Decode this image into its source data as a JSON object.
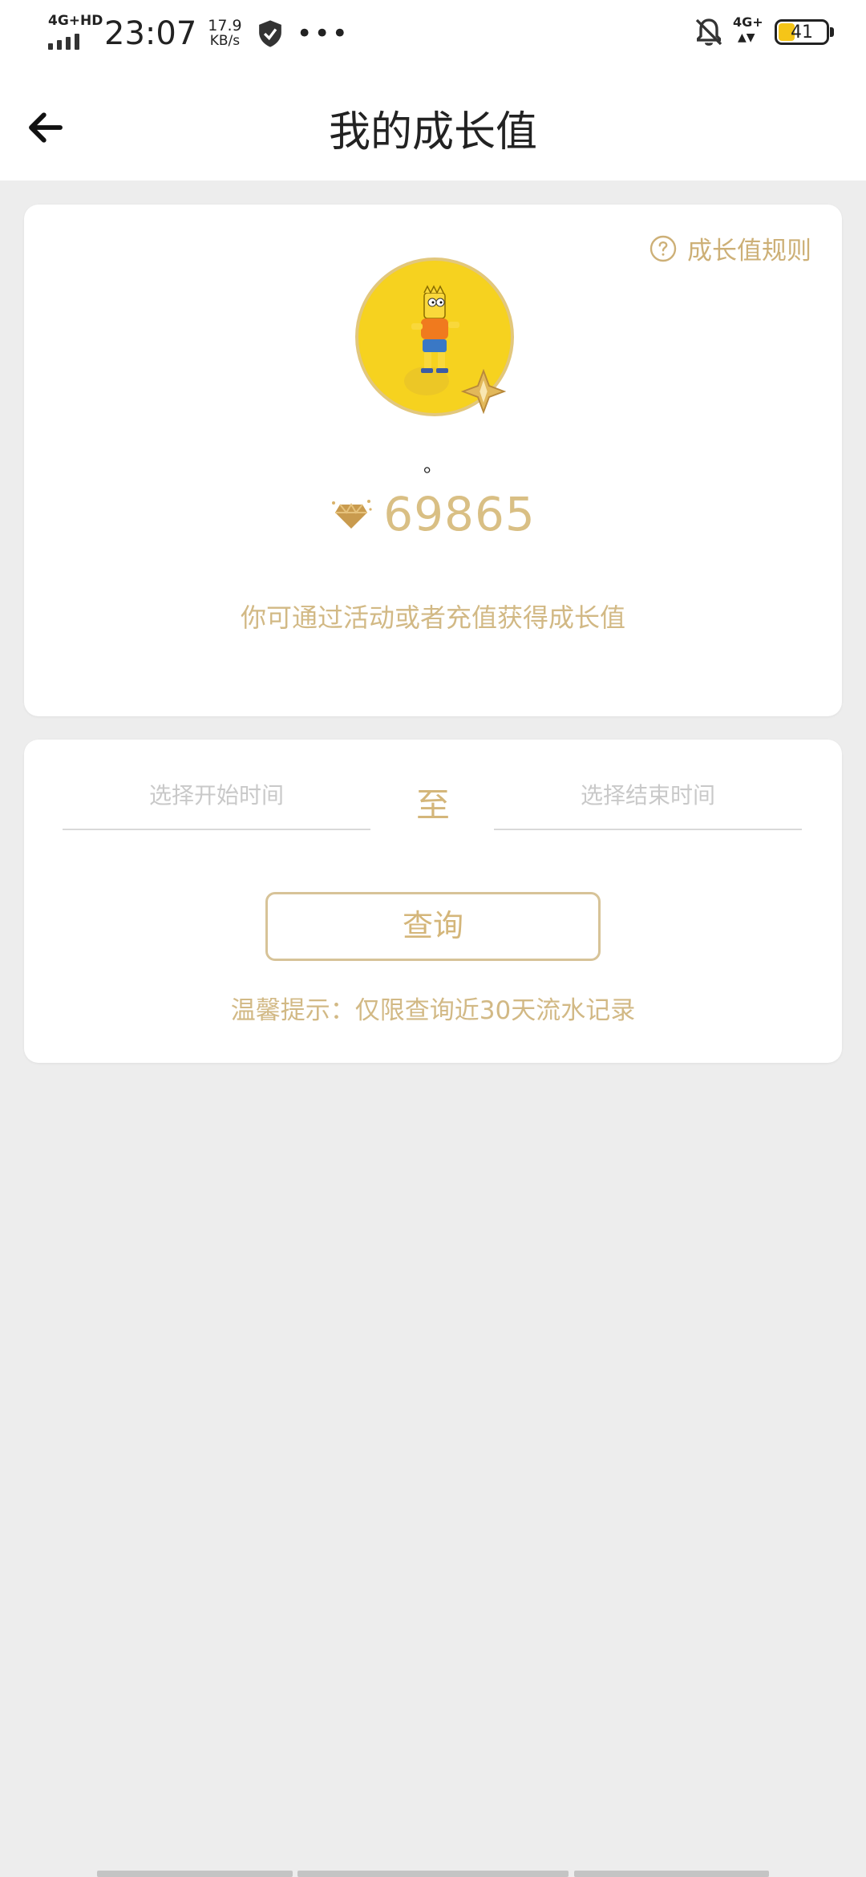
{
  "status_bar": {
    "network_left": "4G+HD",
    "time": "23:07",
    "speed_value": "17.9",
    "speed_unit": "KB/s",
    "dots": "•••",
    "network_right": "4G+",
    "battery_percent": "41"
  },
  "header": {
    "title": "我的成长值"
  },
  "profile": {
    "rules_link": "成长值规则",
    "username": "。",
    "growth_value": "69865",
    "hint": "你可通过活动或者充值获得成长值"
  },
  "query": {
    "start_placeholder": "选择开始时间",
    "to_label": "至",
    "end_placeholder": "选择结束时间",
    "query_button": "查询",
    "tip": "温馨提示：仅限查询近30天流水记录"
  },
  "colors": {
    "accent_gold": "#d4b67a",
    "background": "#ededed",
    "avatar_yellow": "#f6d21f"
  }
}
